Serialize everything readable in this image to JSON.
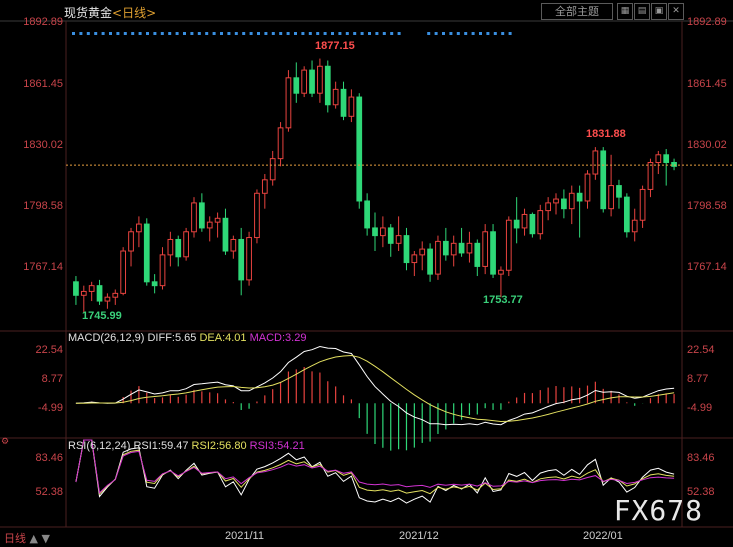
{
  "header": {
    "instrument": "现货黄金",
    "timeframe_label": "<日线>",
    "menu_button": "全部主题",
    "tool_icons": [
      "grid-icon",
      "chart-icon",
      "fullscreen-icon",
      "close-icon"
    ]
  },
  "main_chart": {
    "y_ticks": [
      "1892.89",
      "1861.45",
      "1830.02",
      "1798.58",
      "1767.14"
    ],
    "ylim": [
      1738,
      1897
    ],
    "current_price_line": 1822.6,
    "annotations": {
      "high": "1877.15",
      "low1": "1745.99",
      "low2": "1753.77",
      "recent_high": "1831.88"
    },
    "dot_markers": 60
  },
  "macd": {
    "label": "MACD(26,12,9)",
    "diff": "DIFF:5.65",
    "dea": "DEA:4.01",
    "macd": "MACD:3.29",
    "y_ticks": [
      "22.54",
      "8.77",
      "-4.99"
    ],
    "ylim": [
      -14,
      27
    ]
  },
  "rsi": {
    "label": "RSI(6,12,24)",
    "rsi1": "RSI1:59.47",
    "rsi2": "RSI2:56.80",
    "rsi3": "RSI3:54.21",
    "y_ticks": [
      "83.46",
      "52.38"
    ],
    "ylim": [
      0,
      100
    ]
  },
  "x_axis": {
    "labels": [
      "2021/11",
      "2021/12",
      "2022/01"
    ],
    "bottom_tab": "日线"
  },
  "watermark": "FX678",
  "colors": {
    "up": "#e8433f",
    "down": "#2fd878",
    "diff": "#ffffff",
    "dea": "#e3e060",
    "rsi3": "#d233d3",
    "axis": "#c8444a",
    "price_line": "#e8a040"
  },
  "chart_data": {
    "type": "candlestick",
    "candles": [
      [
        1762,
        1765,
        1750,
        1755
      ],
      [
        1755,
        1760,
        1746,
        1757
      ],
      [
        1757,
        1762,
        1752,
        1760
      ],
      [
        1760,
        1763,
        1750,
        1752
      ],
      [
        1752,
        1756,
        1748,
        1754
      ],
      [
        1754,
        1758,
        1750,
        1756
      ],
      [
        1756,
        1780,
        1755,
        1778
      ],
      [
        1778,
        1790,
        1770,
        1788
      ],
      [
        1788,
        1796,
        1780,
        1792
      ],
      [
        1792,
        1795,
        1760,
        1762
      ],
      [
        1762,
        1766,
        1756,
        1760
      ],
      [
        1760,
        1780,
        1758,
        1776
      ],
      [
        1776,
        1788,
        1770,
        1784
      ],
      [
        1784,
        1786,
        1770,
        1775
      ],
      [
        1775,
        1790,
        1773,
        1788
      ],
      [
        1788,
        1806,
        1785,
        1803
      ],
      [
        1803,
        1808,
        1788,
        1790
      ],
      [
        1790,
        1796,
        1783,
        1793
      ],
      [
        1793,
        1798,
        1785,
        1795
      ],
      [
        1795,
        1800,
        1776,
        1778
      ],
      [
        1778,
        1786,
        1774,
        1784
      ],
      [
        1784,
        1790,
        1755,
        1763
      ],
      [
        1763,
        1788,
        1760,
        1785
      ],
      [
        1785,
        1810,
        1782,
        1808
      ],
      [
        1808,
        1818,
        1800,
        1815
      ],
      [
        1815,
        1830,
        1812,
        1826
      ],
      [
        1826,
        1845,
        1822,
        1842
      ],
      [
        1842,
        1872,
        1840,
        1868
      ],
      [
        1868,
        1876,
        1855,
        1860
      ],
      [
        1860,
        1874,
        1858,
        1872
      ],
      [
        1872,
        1877,
        1858,
        1860
      ],
      [
        1860,
        1878,
        1855,
        1874
      ],
      [
        1874,
        1877,
        1850,
        1854
      ],
      [
        1854,
        1866,
        1852,
        1862
      ],
      [
        1862,
        1866,
        1846,
        1848
      ],
      [
        1848,
        1862,
        1845,
        1858
      ],
      [
        1858,
        1860,
        1800,
        1804
      ],
      [
        1804,
        1808,
        1786,
        1790
      ],
      [
        1790,
        1798,
        1778,
        1786
      ],
      [
        1786,
        1796,
        1780,
        1790
      ],
      [
        1790,
        1792,
        1775,
        1782
      ],
      [
        1782,
        1796,
        1778,
        1786
      ],
      [
        1786,
        1790,
        1768,
        1772
      ],
      [
        1772,
        1778,
        1765,
        1776
      ],
      [
        1776,
        1783,
        1768,
        1779
      ],
      [
        1779,
        1782,
        1762,
        1766
      ],
      [
        1766,
        1786,
        1763,
        1783
      ],
      [
        1783,
        1790,
        1773,
        1776
      ],
      [
        1776,
        1786,
        1770,
        1782
      ],
      [
        1782,
        1790,
        1775,
        1777
      ],
      [
        1777,
        1788,
        1772,
        1782
      ],
      [
        1782,
        1784,
        1765,
        1770
      ],
      [
        1770,
        1792,
        1766,
        1788
      ],
      [
        1788,
        1792,
        1764,
        1766
      ],
      [
        1766,
        1770,
        1754,
        1768
      ],
      [
        1768,
        1796,
        1765,
        1794
      ],
      [
        1794,
        1806,
        1782,
        1790
      ],
      [
        1790,
        1800,
        1786,
        1797
      ],
      [
        1797,
        1798,
        1785,
        1787
      ],
      [
        1787,
        1802,
        1784,
        1799
      ],
      [
        1799,
        1806,
        1794,
        1803
      ],
      [
        1803,
        1808,
        1797,
        1805
      ],
      [
        1805,
        1810,
        1795,
        1800
      ],
      [
        1800,
        1812,
        1792,
        1808
      ],
      [
        1808,
        1812,
        1785,
        1804
      ],
      [
        1804,
        1820,
        1800,
        1818
      ],
      [
        1818,
        1832,
        1815,
        1830
      ],
      [
        1830,
        1832,
        1798,
        1800
      ],
      [
        1800,
        1828,
        1796,
        1812
      ],
      [
        1812,
        1815,
        1800,
        1806
      ],
      [
        1806,
        1808,
        1785,
        1788
      ],
      [
        1788,
        1800,
        1783,
        1794
      ],
      [
        1794,
        1812,
        1790,
        1810
      ],
      [
        1810,
        1826,
        1806,
        1824
      ],
      [
        1824,
        1830,
        1818,
        1828
      ],
      [
        1828,
        1831,
        1812,
        1824
      ],
      [
        1824,
        1826,
        1820,
        1822
      ]
    ]
  }
}
